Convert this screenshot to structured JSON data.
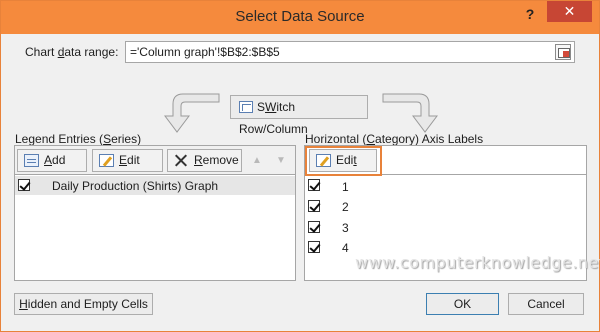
{
  "window": {
    "title": "Select Data Source",
    "help_label": "?",
    "close_label": "✕"
  },
  "range": {
    "label_pre": "Chart ",
    "label_ul": "d",
    "label_post": "ata range:",
    "value": "='Column graph'!$B$2:$B$5"
  },
  "switch": {
    "label_ul": "W",
    "label_pre": "S",
    "label_post": "itch Row/Column"
  },
  "legend": {
    "label_pre": "Legend Entries (",
    "label_ul": "S",
    "label_post": "eries)",
    "add_ul": "A",
    "add_post": "dd",
    "edit_ul": "E",
    "edit_post": "dit",
    "remove_ul": "R",
    "remove_post": "emove",
    "up_icon": "▲",
    "down_icon": "▼",
    "series": [
      {
        "label": "Daily Production (Shirts) Graph",
        "checked": true
      }
    ]
  },
  "category": {
    "label_pre": "Horizontal (",
    "label_ul": "C",
    "label_post": "ategory) Axis Labels",
    "edit_pre": "Edi",
    "edit_ul": "t",
    "items": [
      {
        "label": "1",
        "checked": true
      },
      {
        "label": "2",
        "checked": true
      },
      {
        "label": "3",
        "checked": true
      },
      {
        "label": "4",
        "checked": true
      }
    ]
  },
  "footer": {
    "hidden_ul": "H",
    "hidden_post": "idden and Empty Cells",
    "ok_label": "OK",
    "cancel_label": "Cancel"
  },
  "watermark": "www.computerknowledge.net",
  "colors": {
    "titlebar": "#f58a3d",
    "close": "#c74634",
    "highlight": "#e8823a"
  }
}
